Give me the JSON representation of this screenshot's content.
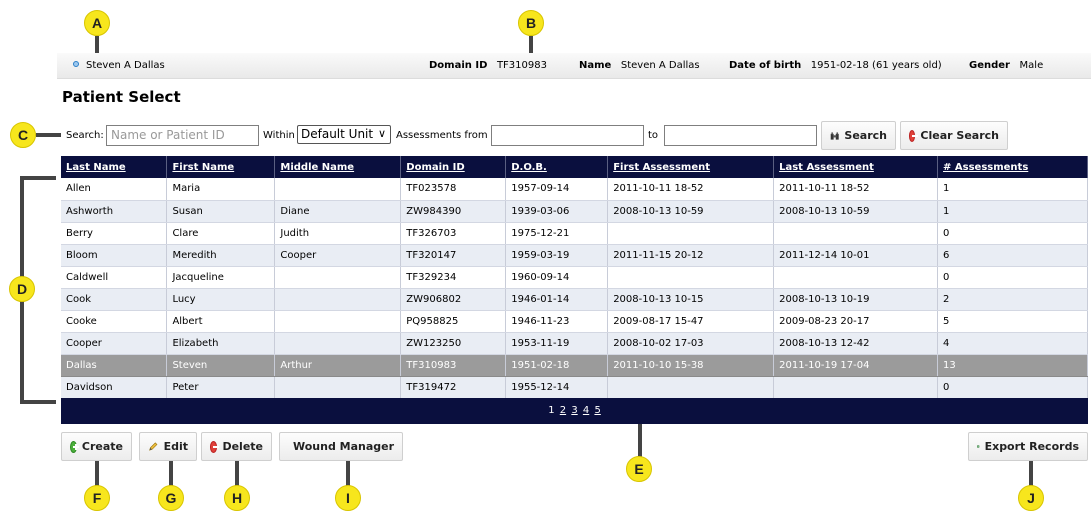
{
  "header": {
    "patient_short": "Steven A Dallas",
    "domain_id_label": "Domain ID",
    "domain_id": "TF310983",
    "name_label": "Name",
    "name": "Steven A Dallas",
    "dob_label": "Date of birth",
    "dob": "1951-02-18 (61 years old)",
    "gender_label": "Gender",
    "gender": "Male"
  },
  "page_title": "Patient Select",
  "search": {
    "label": "Search:",
    "placeholder": "Name or Patient ID",
    "within_label": "Within",
    "within_value": "Default Unit",
    "assessments_from_label": "Assessments from",
    "to_label": "to",
    "search_button": "Search",
    "clear_button": "Clear Search"
  },
  "table": {
    "columns": [
      "Last Name",
      "First Name",
      "Middle Name",
      "Domain ID",
      "D.O.B.",
      "First Assessment",
      "Last Assessment",
      "# Assessments"
    ],
    "rows": [
      [
        "Allen",
        "Maria",
        "",
        "TF023578",
        "1957-09-14",
        "2011-10-11 18-52",
        "2011-10-11 18-52",
        "1"
      ],
      [
        "Ashworth",
        "Susan",
        "Diane",
        "ZW984390",
        "1939-03-06",
        "2008-10-13 10-59",
        "2008-10-13 10-59",
        "1"
      ],
      [
        "Berry",
        "Clare",
        "Judith",
        "TF326703",
        "1975-12-21",
        "",
        "",
        "0"
      ],
      [
        "Bloom",
        "Meredith",
        "Cooper",
        "TF320147",
        "1959-03-19",
        "2011-11-15 20-12",
        "2011-12-14 10-01",
        "6"
      ],
      [
        "Caldwell",
        "Jacqueline",
        "",
        "TF329234",
        "1960-09-14",
        "",
        "",
        "0"
      ],
      [
        "Cook",
        "Lucy",
        "",
        "ZW906802",
        "1946-01-14",
        "2008-10-13 10-15",
        "2008-10-13 10-19",
        "2"
      ],
      [
        "Cooke",
        "Albert",
        "",
        "PQ958825",
        "1946-11-23",
        "2009-08-17 15-47",
        "2009-08-23 20-17",
        "5"
      ],
      [
        "Cooper",
        "Elizabeth",
        "",
        "ZW123250",
        "1953-11-19",
        "2008-10-02 17-03",
        "2008-10-13 12-42",
        "4"
      ],
      [
        "Dallas",
        "Steven",
        "Arthur",
        "TF310983",
        "1951-02-18",
        "2011-10-10 15-38",
        "2011-10-19 17-04",
        "13"
      ],
      [
        "Davidson",
        "Peter",
        "",
        "TF319472",
        "1955-12-14",
        "",
        "",
        "0"
      ]
    ],
    "selected_row": 8
  },
  "pager": {
    "pages": [
      "1",
      "2",
      "3",
      "4",
      "5"
    ],
    "current": "1"
  },
  "actions": {
    "create": "Create",
    "edit": "Edit",
    "delete": "Delete",
    "wound_manager": "Wound Manager",
    "export": "Export Records"
  },
  "callouts": [
    "A",
    "B",
    "C",
    "D",
    "E",
    "F",
    "G",
    "H",
    "I",
    "J"
  ],
  "colors": {
    "table_header_bg": "#0a0f3e",
    "row_alt_bg": "#e9edf4",
    "selected_row_bg": "#9b9b9b",
    "callout_yellow": "#f7e61d"
  }
}
